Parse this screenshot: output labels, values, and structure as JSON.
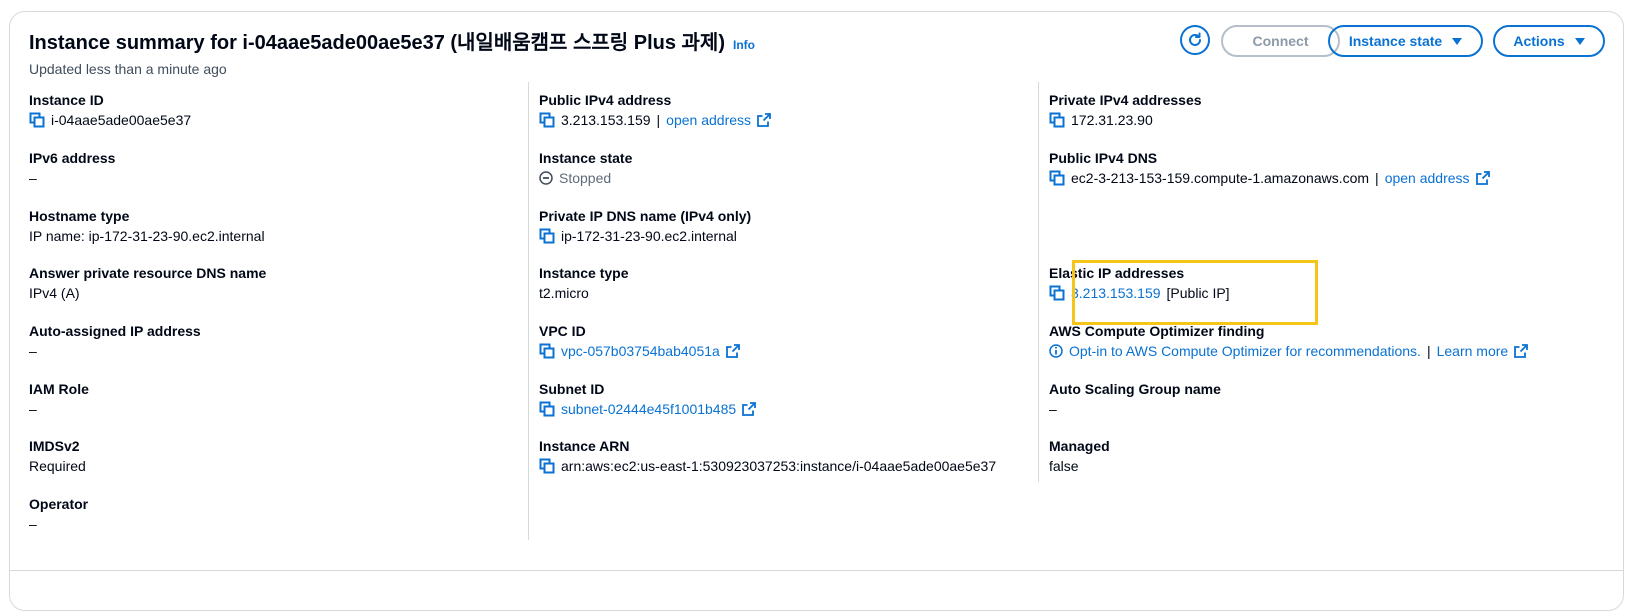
{
  "header": {
    "title": "Instance summary for i-04aae5ade00ae5e37 (내일배움캠프 스프링 Plus 과제)",
    "info_label": "Info",
    "subtitle": "Updated less than a minute ago",
    "connect_label": "Connect",
    "instance_state_label": "Instance state",
    "actions_label": "Actions"
  },
  "col1": {
    "instance_id_label": "Instance ID",
    "instance_id_value": "i-04aae5ade00ae5e37",
    "ipv6_label": "IPv6 address",
    "ipv6_value": "–",
    "hostname_type_label": "Hostname type",
    "hostname_type_value": "IP name: ip-172-31-23-90.ec2.internal",
    "answer_dns_label": "Answer private resource DNS name",
    "answer_dns_value": "IPv4 (A)",
    "auto_ip_label": "Auto-assigned IP address",
    "auto_ip_value": "–",
    "iam_role_label": "IAM Role",
    "iam_role_value": "–",
    "imdsv2_label": "IMDSv2",
    "imdsv2_value": "Required",
    "operator_label": "Operator",
    "operator_value": "–"
  },
  "col2": {
    "public_ipv4_label": "Public IPv4 address",
    "public_ipv4_value": "3.213.153.159",
    "separator": "|",
    "open_address_label": "open address",
    "instance_state_label": "Instance state",
    "instance_state_value": "Stopped",
    "private_dns_label": "Private IP DNS name (IPv4 only)",
    "private_dns_value": "ip-172-31-23-90.ec2.internal",
    "instance_type_label": "Instance type",
    "instance_type_value": "t2.micro",
    "vpc_id_label": "VPC ID",
    "vpc_id_value": "vpc-057b03754bab4051a",
    "subnet_id_label": "Subnet ID",
    "subnet_id_value": "subnet-02444e45f1001b485",
    "instance_arn_label": "Instance ARN",
    "instance_arn_value": "arn:aws:ec2:us-east-1:530923037253:instance/i-04aae5ade00ae5e37"
  },
  "col3": {
    "private_ipv4_label": "Private IPv4 addresses",
    "private_ipv4_value": "172.31.23.90",
    "public_dns_label": "Public IPv4 DNS",
    "public_dns_value": "ec2-3-213-153-159.compute-1.amazonaws.com",
    "separator": "|",
    "open_address_label": "open address",
    "elastic_ip_label": "Elastic IP addresses",
    "elastic_ip_value": "3.213.153.159",
    "elastic_ip_suffix": "[Public IP]",
    "optimizer_label": "AWS Compute Optimizer finding",
    "optimizer_value": "Opt-in to AWS Compute Optimizer for recommendations.",
    "learn_more_label": "Learn more",
    "asg_label": "Auto Scaling Group name",
    "asg_value": "–",
    "managed_label": "Managed",
    "managed_value": "false"
  },
  "colors": {
    "link": "#0972d3",
    "highlight": "#f5c518",
    "text": "#000716",
    "disabled": "#8d99a8"
  }
}
